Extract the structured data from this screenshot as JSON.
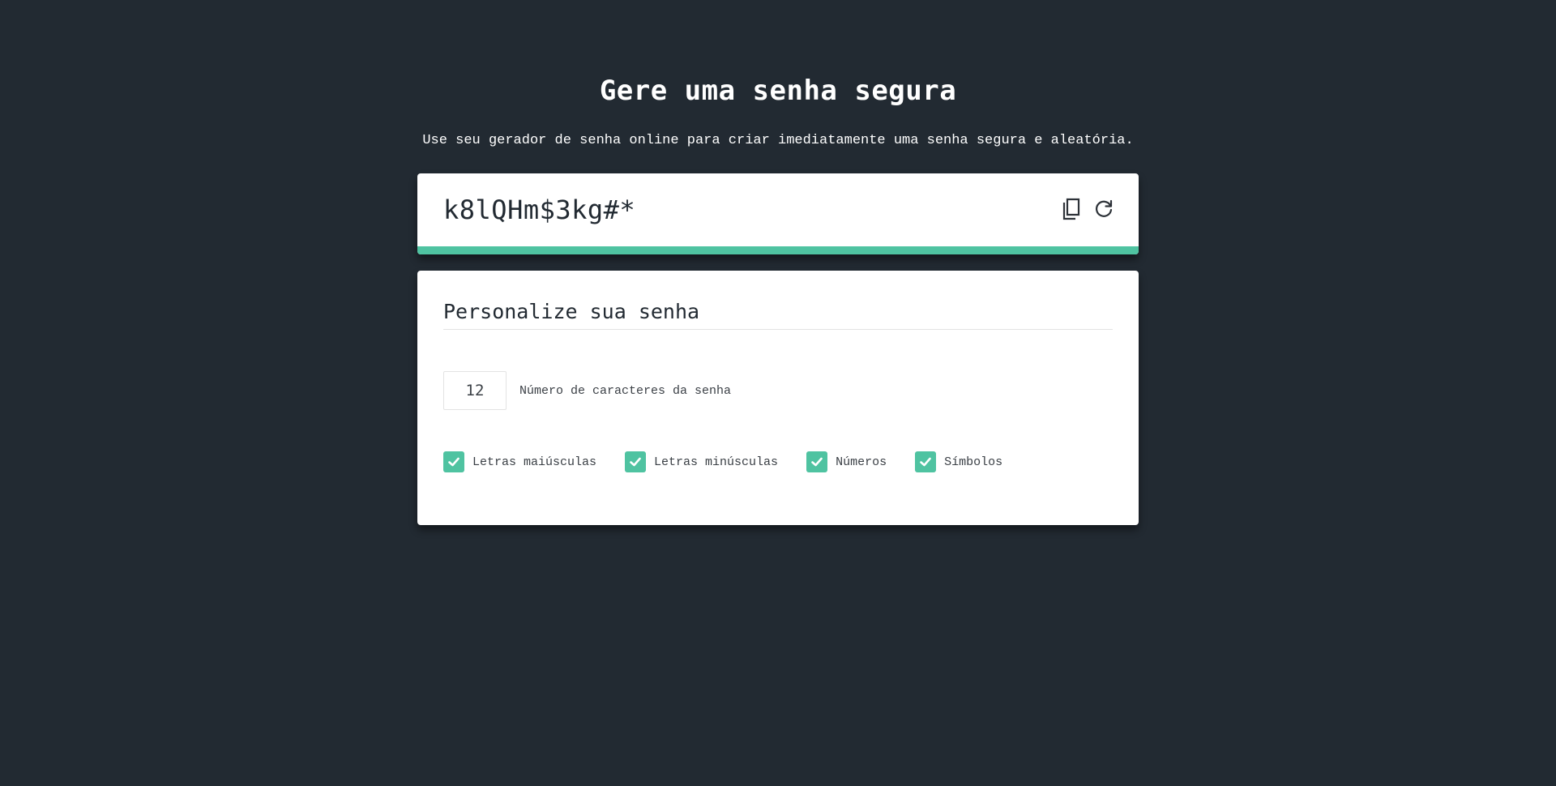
{
  "header": {
    "title": "Gere uma senha segura",
    "subtitle": "Use seu gerador de senha online para criar imediatamente uma senha segura e aleatória."
  },
  "password": {
    "value": "k8lQHm$3kg#*",
    "copy_icon": "copy-icon",
    "refresh_icon": "refresh-icon",
    "strength_fraction": 1.0,
    "strength_color": "#4fc3a1"
  },
  "customize": {
    "heading": "Personalize sua senha",
    "length": {
      "value": "12",
      "label": "Número de caracteres da senha"
    },
    "options": [
      {
        "label": "Letras maiúsculas",
        "checked": true
      },
      {
        "label": "Letras minúsculas",
        "checked": true
      },
      {
        "label": "Números",
        "checked": true
      },
      {
        "label": "Símbolos",
        "checked": true
      }
    ]
  },
  "colors": {
    "background": "#222a32",
    "accent": "#4fc3a1",
    "card": "#ffffff"
  }
}
